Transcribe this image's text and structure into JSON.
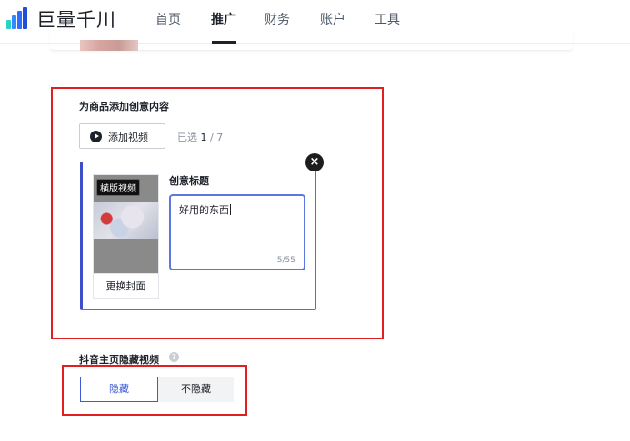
{
  "header": {
    "brand": "巨量千川",
    "nav": [
      "首页",
      "推广",
      "财务",
      "账户",
      "工具"
    ],
    "active_nav": "推广"
  },
  "creative": {
    "section_title": "为商品添加创意内容",
    "add_video_label": "添加视频",
    "selected_prefix": "已选",
    "selected_count": "1",
    "selected_total": "/ 7",
    "card": {
      "thumb_tag": "横版视频",
      "cover_button": "更换封面",
      "title_label": "创意标题",
      "title_value": "好用的东西",
      "char_count": "5/55",
      "close_icon": "close-icon"
    }
  },
  "homepage_hide": {
    "label": "抖音主页隐藏视频",
    "options": [
      "隐藏",
      "不隐藏"
    ],
    "selected": "隐藏"
  },
  "colors": {
    "annotation_red": "#e02020",
    "accent_blue": "#3d5bd9",
    "logo_blue": "#2f6bff",
    "logo_teal": "#2ad1c9"
  }
}
